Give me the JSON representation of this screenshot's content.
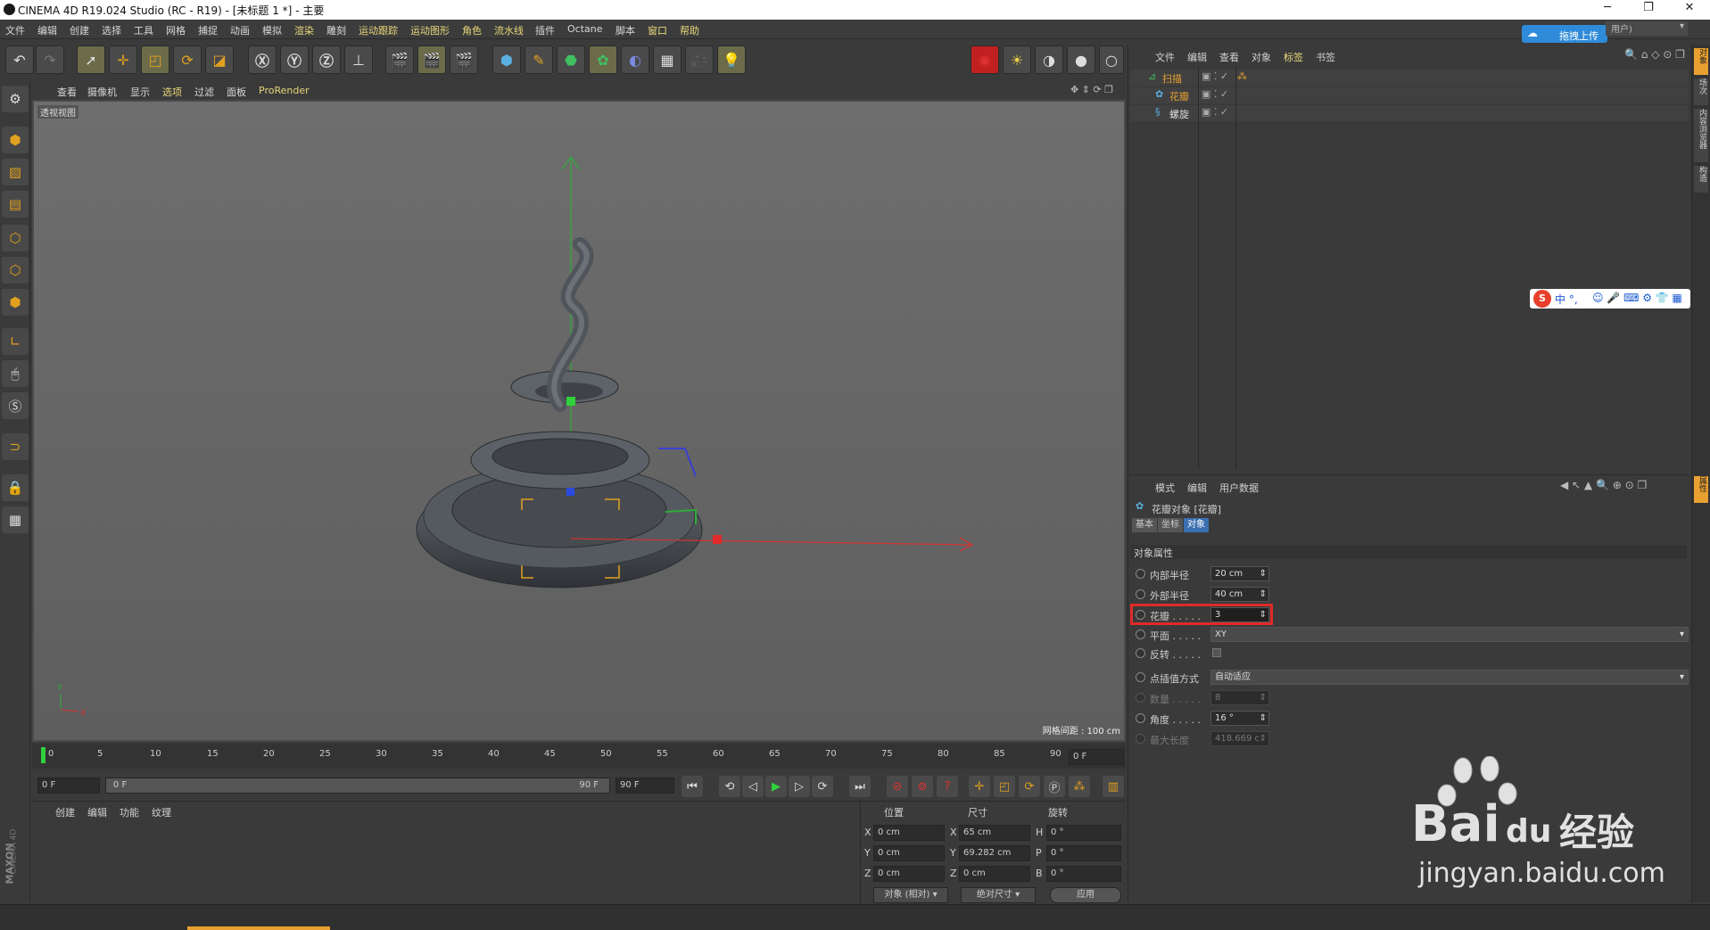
{
  "title_bar": {
    "title": "CINEMA 4D R19.024 Studio (RC - R19) - [未标题 1 *] - 主要",
    "upload_btn": "拖拽上传",
    "user_label": "用户)"
  },
  "menu": [
    "文件",
    "编辑",
    "创建",
    "选择",
    "工具",
    "网格",
    "捕捉",
    "动画",
    "模拟",
    "渲染",
    "雕刻",
    "运动跟踪",
    "运动图形",
    "角色",
    "流水线",
    "插件",
    "Octane",
    "脚本",
    "窗口",
    "帮助"
  ],
  "viewport": {
    "menu": [
      "查看",
      "摄像机",
      "显示",
      "选项",
      "过滤",
      "面板",
      "ProRender"
    ],
    "label": "透视视图",
    "grid_spacing": "网格间距 : 100 cm"
  },
  "timeline": {
    "ticks": [
      "0",
      "5",
      "10",
      "15",
      "20",
      "25",
      "30",
      "35",
      "40",
      "45",
      "50",
      "55",
      "60",
      "65",
      "70",
      "75",
      "80",
      "85",
      "90"
    ],
    "current_frame": "0 F"
  },
  "transport": {
    "start_field": "0 F",
    "slider_left": "0 F",
    "slider_right": "90 F",
    "end_field": "90 F"
  },
  "material_manager": {
    "menu": [
      "创建",
      "编辑",
      "功能",
      "纹理"
    ]
  },
  "coordinates": {
    "headers": [
      "位置",
      "尺寸",
      "旋转"
    ],
    "rows": [
      {
        "a": "X",
        "pos": "0 cm",
        "b": "X",
        "size": "65 cm",
        "c": "H",
        "rot": "0 °"
      },
      {
        "a": "Y",
        "pos": "0 cm",
        "b": "Y",
        "size": "69.282 cm",
        "c": "P",
        "rot": "0 °"
      },
      {
        "a": "Z",
        "pos": "0 cm",
        "b": "Z",
        "size": "0 cm",
        "c": "B",
        "rot": "0 °"
      }
    ],
    "mode": "对象 (相对)",
    "size_mode": "绝对尺寸",
    "apply": "应用"
  },
  "object_manager": {
    "menu": [
      "文件",
      "编辑",
      "查看",
      "对象",
      "标签",
      "书签"
    ],
    "objects": [
      {
        "name": "扫描",
        "level": 0
      },
      {
        "name": "花瓣",
        "level": 1
      },
      {
        "name": "螺旋",
        "level": 1
      }
    ]
  },
  "attribute_manager": {
    "menu": [
      "模式",
      "编辑",
      "用户数据"
    ],
    "object_title": "花瓣对象 [花瓣]",
    "tabs": [
      "基本",
      "坐标",
      "对象"
    ],
    "section": "对象属性",
    "props": [
      {
        "label": "内部半径",
        "value": "20 cm",
        "dim": false
      },
      {
        "label": "外部半径",
        "value": "40 cm",
        "dim": false
      },
      {
        "label": "花瓣 . . . . .",
        "value": "3",
        "dim": false,
        "highlight": true
      },
      {
        "label": "平面 . . . . .",
        "value": "XY",
        "dim": false,
        "wide": true
      },
      {
        "label": "反转 . . . . .",
        "value": "",
        "dim": false,
        "checkbox": true
      },
      {
        "label": "点插值方式",
        "value": "自动适应",
        "dim": false,
        "wide": true
      },
      {
        "label": "数量 . . . . .",
        "value": "8",
        "dim": true
      },
      {
        "label": "角度 . . . . .",
        "value": "16 °",
        "dim": false
      },
      {
        "label": "最大长度",
        "value": "418.669 c",
        "dim": true
      }
    ]
  },
  "right_tabs": [
    "对象",
    "场次",
    "内容浏览器",
    "构造",
    "属性"
  ],
  "left_brand": [
    "MAXON",
    "CINEMA 4D"
  ],
  "ime_bar": "中 °,",
  "watermark": {
    "brand": "Bai",
    "brand2": "du",
    "cn": "经验",
    "url": "jingyan.baidu.com"
  }
}
